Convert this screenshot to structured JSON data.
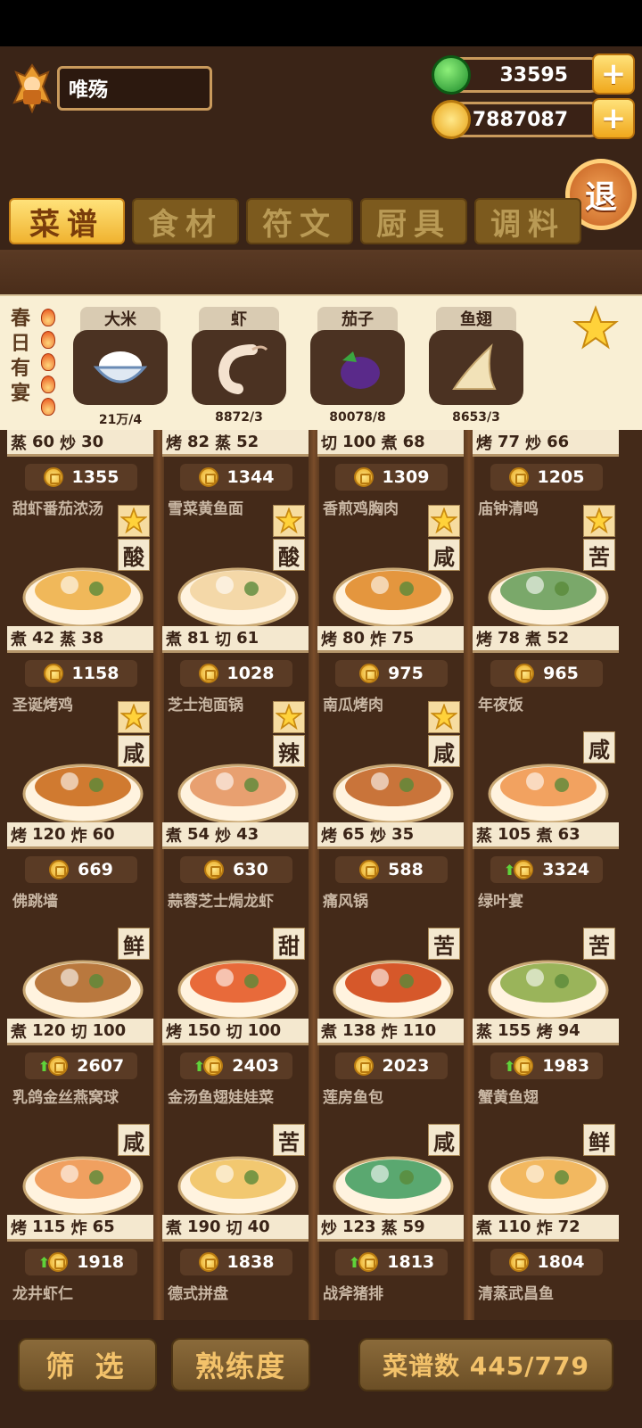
{
  "player": {
    "name": "唯殇"
  },
  "currency": {
    "jade": "33595",
    "coins": "7887087"
  },
  "exit_label": "退",
  "tabs": [
    {
      "label": "菜谱",
      "active": true
    },
    {
      "label": "食材",
      "active": false
    },
    {
      "label": "符文",
      "active": false
    },
    {
      "label": "厨具",
      "active": false
    },
    {
      "label": "调料",
      "active": false
    }
  ],
  "event": {
    "title": "春日有宴",
    "ingredients": [
      {
        "name": "大米",
        "count": "21万/4"
      },
      {
        "name": "虾",
        "count": "8872/3"
      },
      {
        "name": "茄子",
        "count": "80078/8"
      },
      {
        "name": "鱼翅",
        "count": "8653/3"
      }
    ]
  },
  "top_row": [
    {
      "s1": "蒸",
      "v1": "60",
      "s2": "炒",
      "v2": "30",
      "price": "1355"
    },
    {
      "s1": "烤",
      "v1": "82",
      "s2": "蒸",
      "v2": "52",
      "price": "1344"
    },
    {
      "s1": "切",
      "v1": "100",
      "s2": "煮",
      "v2": "68",
      "price": "1309"
    },
    {
      "s1": "烤",
      "v1": "77",
      "s2": "炒",
      "v2": "66",
      "price": "1205"
    }
  ],
  "recipes": [
    {
      "name": "甜虾番茄浓汤",
      "taste": "酸",
      "fav": true,
      "s1": "煮",
      "v1": "42",
      "s2": "蒸",
      "v2": "38",
      "price": "1158",
      "up": false
    },
    {
      "name": "雪菜黄鱼面",
      "taste": "酸",
      "fav": true,
      "s1": "煮",
      "v1": "81",
      "s2": "切",
      "v2": "61",
      "price": "1028",
      "up": false
    },
    {
      "name": "香煎鸡胸肉",
      "taste": "咸",
      "fav": true,
      "s1": "烤",
      "v1": "80",
      "s2": "炸",
      "v2": "75",
      "price": "975",
      "up": false
    },
    {
      "name": "庙钟清鸣",
      "taste": "苦",
      "fav": true,
      "s1": "烤",
      "v1": "78",
      "s2": "煮",
      "v2": "52",
      "price": "965",
      "up": false
    },
    {
      "name": "圣诞烤鸡",
      "taste": "咸",
      "fav": true,
      "s1": "烤",
      "v1": "120",
      "s2": "炸",
      "v2": "60",
      "price": "669",
      "up": false
    },
    {
      "name": "芝士泡面锅",
      "taste": "辣",
      "fav": true,
      "s1": "煮",
      "v1": "54",
      "s2": "炒",
      "v2": "43",
      "price": "630",
      "up": false
    },
    {
      "name": "南瓜烤肉",
      "taste": "咸",
      "fav": true,
      "s1": "烤",
      "v1": "65",
      "s2": "炒",
      "v2": "35",
      "price": "588",
      "up": false
    },
    {
      "name": "年夜饭",
      "taste": "咸",
      "fav": false,
      "s1": "蒸",
      "v1": "105",
      "s2": "煮",
      "v2": "63",
      "price": "3324",
      "up": true
    },
    {
      "name": "佛跳墙",
      "taste": "鲜",
      "fav": false,
      "s1": "煮",
      "v1": "120",
      "s2": "切",
      "v2": "100",
      "price": "2607",
      "up": true
    },
    {
      "name": "蒜蓉芝士焗龙虾",
      "taste": "甜",
      "fav": false,
      "s1": "烤",
      "v1": "150",
      "s2": "切",
      "v2": "100",
      "price": "2403",
      "up": true
    },
    {
      "name": "痛风锅",
      "taste": "苦",
      "fav": false,
      "s1": "煮",
      "v1": "138",
      "s2": "炸",
      "v2": "110",
      "price": "2023",
      "up": false
    },
    {
      "name": "绿叶宴",
      "taste": "苦",
      "fav": false,
      "s1": "蒸",
      "v1": "155",
      "s2": "烤",
      "v2": "94",
      "price": "1983",
      "up": true
    },
    {
      "name": "乳鸽金丝燕窝球",
      "taste": "咸",
      "fav": false,
      "s1": "烤",
      "v1": "115",
      "s2": "炸",
      "v2": "65",
      "price": "1918",
      "up": true
    },
    {
      "name": "金汤鱼翅娃娃菜",
      "taste": "苦",
      "fav": false,
      "s1": "煮",
      "v1": "190",
      "s2": "切",
      "v2": "40",
      "price": "1838",
      "up": false
    },
    {
      "name": "莲房鱼包",
      "taste": "咸",
      "fav": false,
      "s1": "炒",
      "v1": "123",
      "s2": "蒸",
      "v2": "59",
      "price": "1813",
      "up": true
    },
    {
      "name": "蟹黄鱼翅",
      "taste": "鲜",
      "fav": false,
      "s1": "煮",
      "v1": "110",
      "s2": "炸",
      "v2": "72",
      "price": "1804",
      "up": false
    }
  ],
  "next_row": [
    "龙井虾仁",
    "德式拼盘",
    "战斧猪排",
    "清蒸武昌鱼"
  ],
  "bottom": {
    "filter": "筛 选",
    "proficiency": "熟练度",
    "recipe_count": "菜谱数 445/779"
  },
  "colors": {
    "accent_gold": "#f0b330",
    "panel_brown": "#3a2417",
    "cream": "#f4e8cf"
  }
}
